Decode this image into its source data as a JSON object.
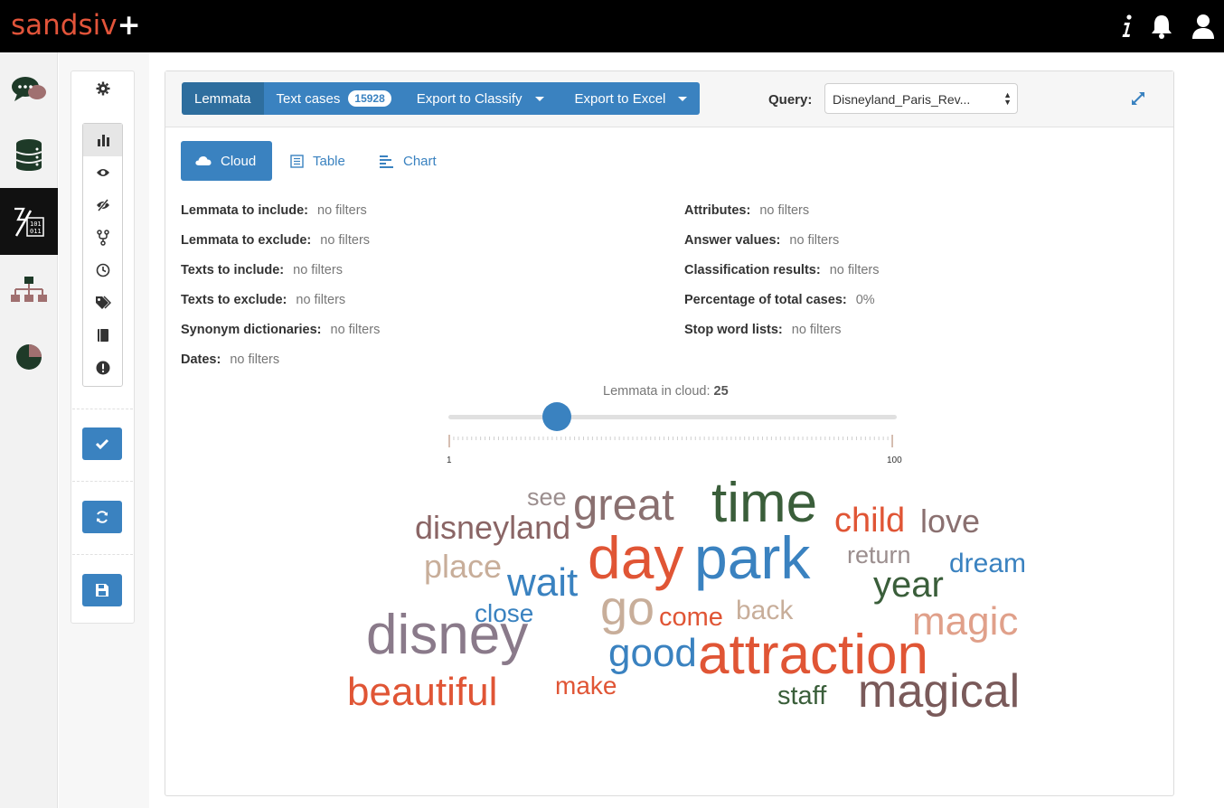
{
  "app": {
    "logo_text": "sandsiv",
    "logo_plus": "+"
  },
  "topbar": {
    "icons": [
      "info-icon",
      "bell-icon",
      "user-icon"
    ]
  },
  "rail": {
    "items": [
      "chat-bubbles-icon",
      "database-icon",
      "text-analytics-icon",
      "hierarchy-icon",
      "pie-chart-icon"
    ],
    "active_index": 2
  },
  "tools": {
    "items": [
      "gear-icon",
      "bar-chart-icon",
      "eye-icon",
      "eye-slash-icon",
      "fork-icon",
      "clock-icon",
      "tags-icon",
      "book-icon",
      "exclamation-icon"
    ],
    "actions": [
      "check-icon",
      "refresh-icon",
      "save-icon"
    ]
  },
  "header": {
    "lemmata_label": "Lemmata",
    "text_cases_label": "Text cases",
    "text_cases_count": "15928",
    "export_classify_label": "Export to Classify",
    "export_excel_label": "Export to Excel",
    "query_label": "Query:",
    "query_value": "Disneyland_Paris_Rev..."
  },
  "view_tabs": {
    "cloud": "Cloud",
    "table": "Table",
    "chart": "Chart",
    "active": "cloud"
  },
  "filters": {
    "left": [
      {
        "key": "Lemmata to include:",
        "value": "no filters"
      },
      {
        "key": "Lemmata to exclude:",
        "value": "no filters"
      },
      {
        "key": "Texts to include:",
        "value": "no filters"
      },
      {
        "key": "Texts to exclude:",
        "value": "no filters"
      },
      {
        "key": "Synonym dictionaries:",
        "value": "no filters"
      },
      {
        "key": "Dates:",
        "value": "no filters"
      }
    ],
    "right": [
      {
        "key": "Attributes:",
        "value": "no filters"
      },
      {
        "key": "Answer values:",
        "value": "no filters"
      },
      {
        "key": "Classification results:",
        "value": "no filters"
      },
      {
        "key": "Percentage of total cases:",
        "value": "0%"
      },
      {
        "key": "Stop word lists:",
        "value": "no filters"
      }
    ]
  },
  "slider": {
    "label": "Lemmata in cloud:",
    "value": 25,
    "min_label": "1",
    "max_label": "100",
    "min": 1,
    "max": 100
  },
  "colors": {
    "accent": "#3a82c0",
    "accent_dark": "#2e6e9e",
    "brand": "#e2543a"
  },
  "cloud": {
    "words": [
      {
        "text": "see",
        "color": "#9b8e8e"
      },
      {
        "text": "great",
        "color": "#8a7070"
      },
      {
        "text": "time",
        "color": "#3a5e3a"
      },
      {
        "text": "child",
        "color": "#e05535"
      },
      {
        "text": "love",
        "color": "#8a7070"
      },
      {
        "text": "disneyland",
        "color": "#8a6565"
      },
      {
        "text": "day",
        "color": "#e05535"
      },
      {
        "text": "park",
        "color": "#3a82c0"
      },
      {
        "text": "return",
        "color": "#9b8e8e"
      },
      {
        "text": "place",
        "color": "#c8ae9a"
      },
      {
        "text": "wait",
        "color": "#3a82c0"
      },
      {
        "text": "year",
        "color": "#3a5e3a"
      },
      {
        "text": "dream",
        "color": "#3a82c0"
      },
      {
        "text": "go",
        "color": "#c8ae9a"
      },
      {
        "text": "close",
        "color": "#3a82c0"
      },
      {
        "text": "come",
        "color": "#e05535"
      },
      {
        "text": "back",
        "color": "#c8ae9a"
      },
      {
        "text": "magic",
        "color": "#e0a08a"
      },
      {
        "text": "disney",
        "color": "#8a7a8a"
      },
      {
        "text": "good",
        "color": "#3a82c0"
      },
      {
        "text": "attraction",
        "color": "#e05535"
      },
      {
        "text": "beautiful",
        "color": "#e05535"
      },
      {
        "text": "make",
        "color": "#e05535"
      },
      {
        "text": "staff",
        "color": "#3a5e3a"
      },
      {
        "text": "magical",
        "color": "#7a5a5a"
      }
    ]
  }
}
